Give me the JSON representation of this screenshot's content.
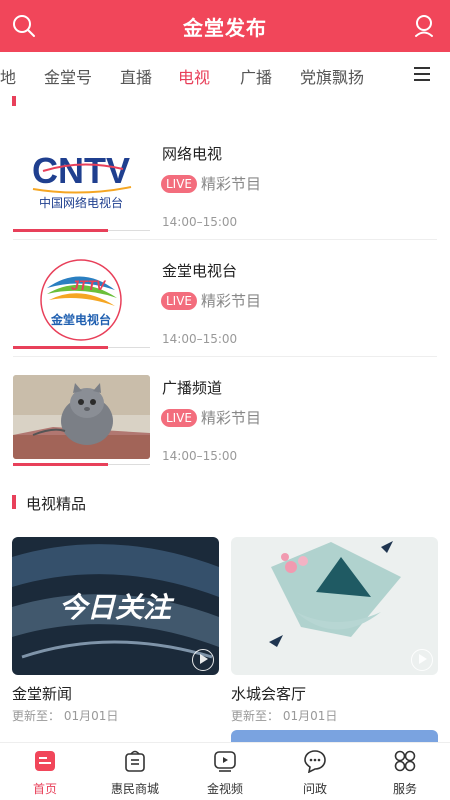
{
  "header": {
    "title": "金堂发布",
    "left_icon": "search-icon",
    "right_icon": "user-icon"
  },
  "tabs": [
    {
      "label": "地",
      "active": false
    },
    {
      "label": "金堂号",
      "active": false
    },
    {
      "label": "直播",
      "active": false
    },
    {
      "label": "电视",
      "active": true
    },
    {
      "label": "广播",
      "active": false
    },
    {
      "label": "党旗飘扬",
      "active": false
    }
  ],
  "tabs_menu_icon": "menu-icon",
  "live_list": [
    {
      "name": "网络电视",
      "badge": "LIVE",
      "program": "精彩节目",
      "time": "14:00–15:00",
      "logo": "CNTV 中国网络电视台"
    },
    {
      "name": "金堂电视台",
      "badge": "LIVE",
      "program": "精彩节目",
      "time": "14:00–15:00",
      "logo": "金堂电视台"
    },
    {
      "name": "广播频道",
      "badge": "LIVE",
      "program": "精彩节目",
      "time": "14:00–15:00",
      "logo": "kitten-photo"
    }
  ],
  "featured": {
    "title": "电视精品",
    "cards": [
      {
        "title": "金堂新闻",
        "updated": "更新至： 01月01日",
        "image_text": "今日关注"
      },
      {
        "title": "水城会客厅",
        "updated": "更新至： 01月01日",
        "image_text": ""
      }
    ]
  },
  "bottom_nav": [
    {
      "label": "首页",
      "icon": "home-icon",
      "active": true
    },
    {
      "label": "惠民商城",
      "icon": "shopping-bag-icon",
      "active": false
    },
    {
      "label": "金视频",
      "icon": "video-icon",
      "active": false
    },
    {
      "label": "问政",
      "icon": "chat-icon",
      "active": false
    },
    {
      "label": "服务",
      "icon": "grid-icon",
      "active": false
    }
  ],
  "colors": {
    "brand": "#f1465a",
    "accent": "#e8405a",
    "live_badge": "#f36d7d"
  }
}
